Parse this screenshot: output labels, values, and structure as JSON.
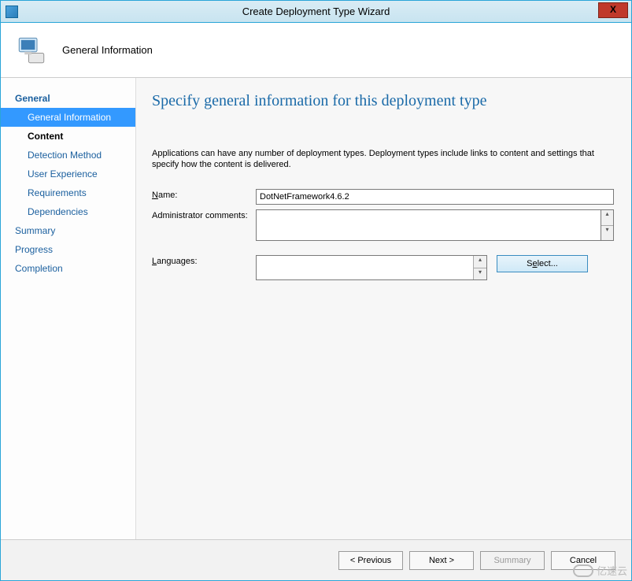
{
  "window": {
    "title": "Create Deployment Type Wizard",
    "close_label": "X"
  },
  "header": {
    "title": "General Information"
  },
  "sidebar": {
    "items": [
      {
        "label": "General",
        "type": "boldblue"
      },
      {
        "label": "General Information",
        "type": "selected sub"
      },
      {
        "label": "Content",
        "type": "bold sub"
      },
      {
        "label": "Detection Method",
        "type": "sub"
      },
      {
        "label": "User Experience",
        "type": "sub"
      },
      {
        "label": "Requirements",
        "type": "sub"
      },
      {
        "label": "Dependencies",
        "type": "sub"
      },
      {
        "label": "Summary",
        "type": ""
      },
      {
        "label": "Progress",
        "type": ""
      },
      {
        "label": "Completion",
        "type": ""
      }
    ]
  },
  "main": {
    "heading": "Specify general information for this deployment type",
    "intro": "Applications can have any number of deployment types. Deployment types include links to content and settings that specify how the content is delivered.",
    "name_label": "Name:",
    "name_value": "DotNetFramework4.6.2",
    "comments_label": "Administrator comments:",
    "comments_value": "",
    "languages_label": "Languages:",
    "languages_value": "",
    "select_label": "Select..."
  },
  "footer": {
    "previous": "< Previous",
    "next": "Next >",
    "summary": "Summary",
    "cancel": "Cancel"
  },
  "watermark": "亿速云"
}
